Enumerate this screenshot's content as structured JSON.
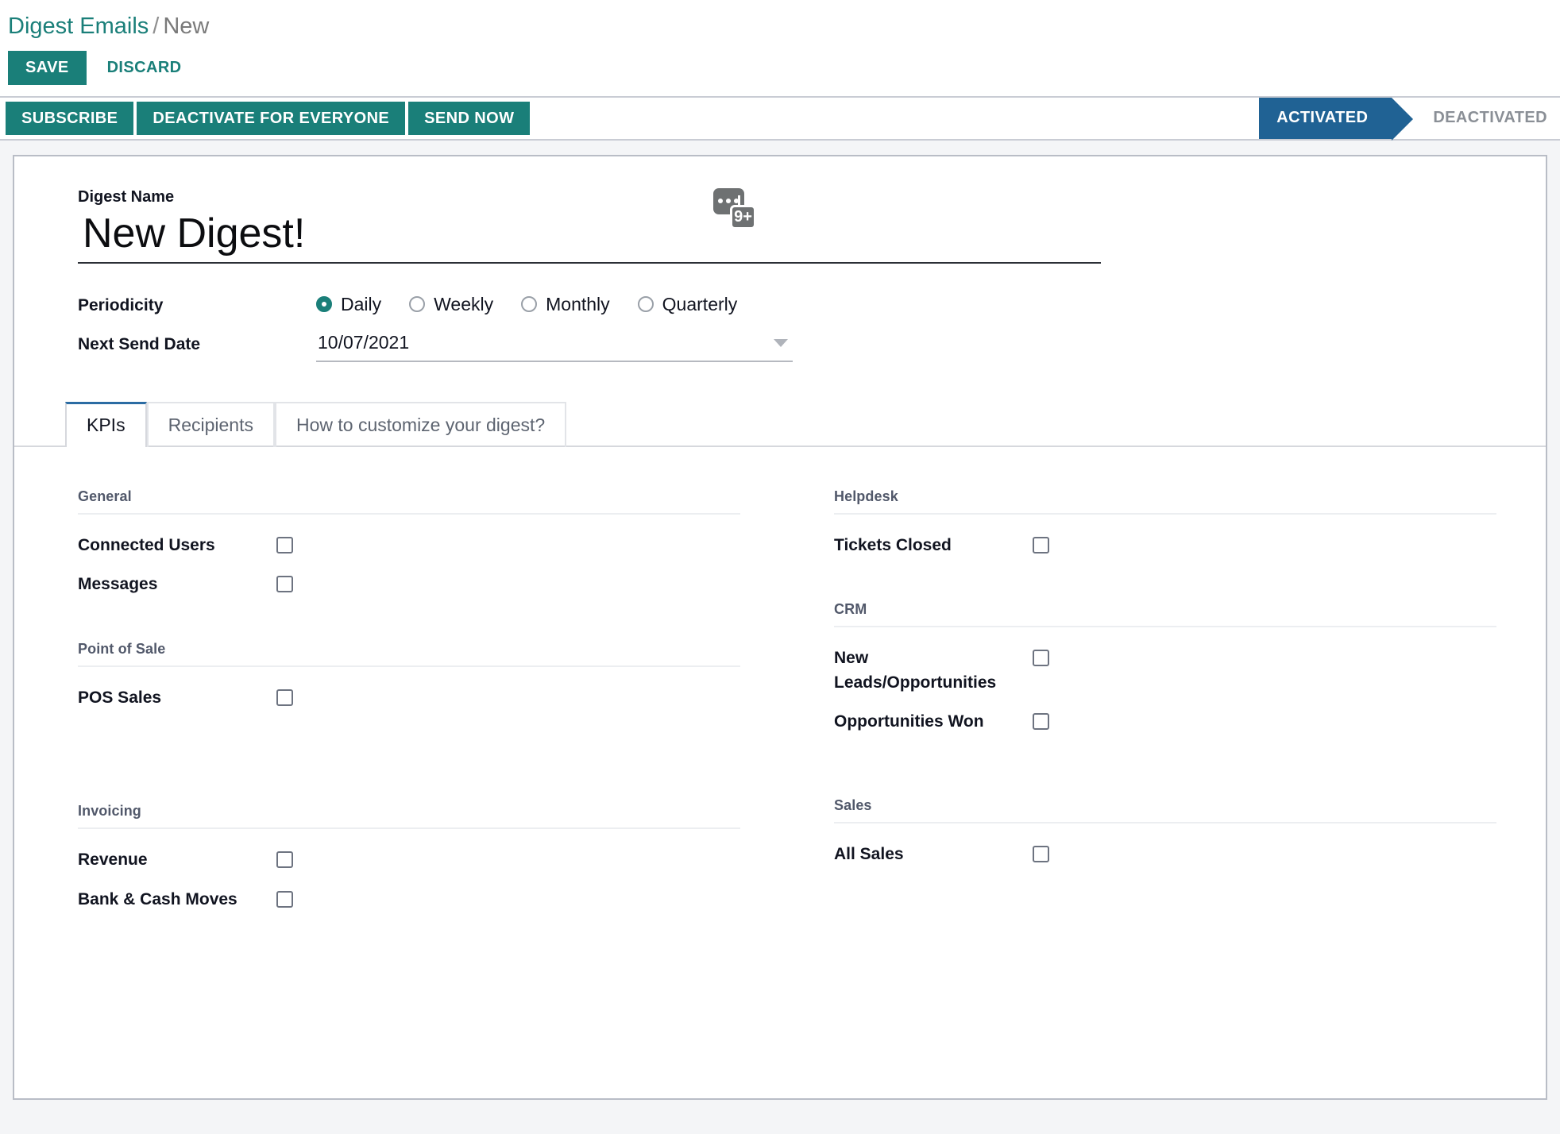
{
  "breadcrumb": {
    "root": "Digest Emails",
    "separator": "/",
    "current": "New"
  },
  "control_panel": {
    "save_label": "SAVE",
    "discard_label": "DISCARD"
  },
  "statusbar": {
    "buttons": [
      {
        "label": "SUBSCRIBE"
      },
      {
        "label": "DEACTIVATE FOR EVERYONE"
      },
      {
        "label": "SEND NOW"
      }
    ],
    "stages": [
      {
        "label": "ACTIVATED",
        "active": true
      },
      {
        "label": "DEACTIVATED",
        "active": false
      }
    ]
  },
  "form": {
    "name_label": "Digest Name",
    "name_value": "New Digest!",
    "name_placeholder": "e.g. Your Weekly Digest",
    "chatter": {
      "icon": "messages-bubble-icon",
      "count": "9+"
    },
    "periodicity": {
      "label": "Periodicity",
      "options": [
        {
          "label": "Daily",
          "selected": true
        },
        {
          "label": "Weekly",
          "selected": false
        },
        {
          "label": "Monthly",
          "selected": false
        },
        {
          "label": "Quarterly",
          "selected": false
        }
      ]
    },
    "next_send_date": {
      "label": "Next Send Date",
      "value": "10/07/2021",
      "placeholder": "MM/DD/YYYY"
    }
  },
  "tabs": [
    {
      "label": "KPIs",
      "active": true
    },
    {
      "label": "Recipients",
      "active": false
    },
    {
      "label": "How to customize your digest?",
      "active": false
    }
  ],
  "kpis": {
    "left": [
      {
        "group": "General",
        "items": [
          {
            "label": "Connected Users",
            "checked": false
          },
          {
            "label": "Messages",
            "checked": false
          }
        ]
      },
      {
        "group": "Point of Sale",
        "items": [
          {
            "label": "POS Sales",
            "checked": false
          }
        ]
      },
      {
        "group": "Invoicing",
        "items": [
          {
            "label": "Revenue",
            "checked": false
          },
          {
            "label": "Bank & Cash Moves",
            "checked": false
          }
        ]
      }
    ],
    "right": [
      {
        "group": "Helpdesk",
        "items": [
          {
            "label": "Tickets Closed",
            "checked": false
          }
        ]
      },
      {
        "group": "CRM",
        "items": [
          {
            "label": "New Leads/Opportunities",
            "checked": false
          },
          {
            "label": "Opportunities Won",
            "checked": false
          }
        ]
      },
      {
        "group": "Sales",
        "items": [
          {
            "label": "All Sales",
            "checked": false
          }
        ]
      }
    ]
  },
  "colors": {
    "primary_teal": "#1a7f79",
    "stage_blue": "#206294",
    "page_bg": "#f4f5f7",
    "text_dark": "#111420",
    "muted": "#7a7a7a"
  }
}
